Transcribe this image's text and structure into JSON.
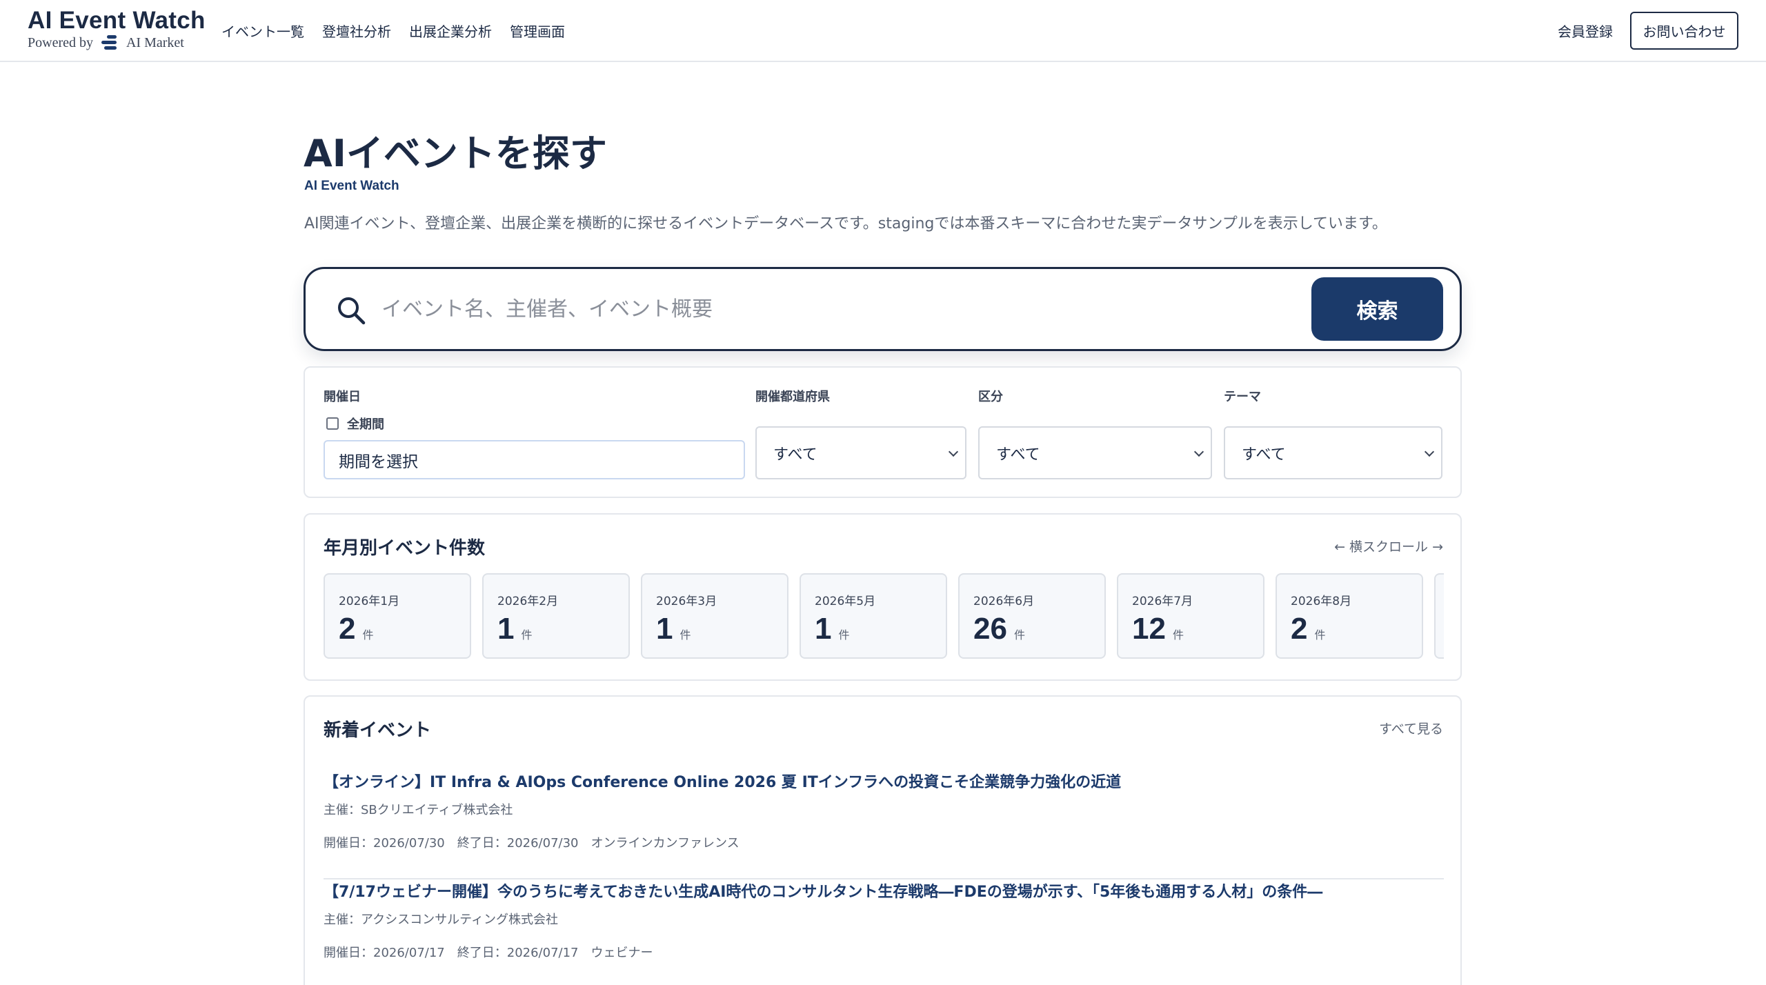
{
  "header": {
    "logo_title": "AI Event Watch",
    "logo_powered": "Powered by",
    "logo_brand": "AI Market",
    "nav": [
      "イベント一覧",
      "登壇社分析",
      "出展企業分析",
      "管理画面"
    ],
    "register_label": "会員登録",
    "contact_label": "お問い合わせ"
  },
  "hero": {
    "title": "AIイベントを探す",
    "subtitle": "AI Event Watch",
    "description": "AI関連イベント、登壇企業、出展企業を横断的に探せるイベントデータベースです。stagingでは本番スキーマに合わせた実データサンプルを表示しています。"
  },
  "search": {
    "placeholder": "イベント名、主催者、イベント概要",
    "button_label": "検索",
    "icon": "search-icon"
  },
  "filters": {
    "date_label": "開催日",
    "all_period_label": "全期間",
    "all_period_checked": false,
    "date_placeholder": "期間を選択",
    "prefecture_label": "開催都道府県",
    "prefecture_value": "すべて",
    "category_label": "区分",
    "category_value": "すべて",
    "theme_label": "テーマ",
    "theme_value": "すべて"
  },
  "monthly": {
    "title": "年月別イベント件数",
    "scroll_hint": "← 横スクロール →",
    "unit": "件",
    "months": [
      {
        "label": "2026年1月",
        "count": "2"
      },
      {
        "label": "2026年2月",
        "count": "1"
      },
      {
        "label": "2026年3月",
        "count": "1"
      },
      {
        "label": "2026年5月",
        "count": "1"
      },
      {
        "label": "2026年6月",
        "count": "26"
      },
      {
        "label": "2026年7月",
        "count": "12"
      },
      {
        "label": "2026年8月",
        "count": "2"
      }
    ]
  },
  "events": {
    "title": "新着イベント",
    "see_all_label": "すべて見る",
    "items": [
      {
        "title": "【オンライン】IT Infra & AIOps Conference Online 2026 夏 ITインフラへの投資こそ企業競争力強化の近道",
        "host": "主催：SBクリエイティブ株式会社",
        "start": "開催日：2026/07/30",
        "end": "終了日：2026/07/30",
        "type": "オンラインカンファレンス"
      },
      {
        "title": "【7/17ウェビナー開催】今のうちに考えておきたい生成AI時代のコンサルタント生存戦略―FDEの登場が示す、「5年後も通用する人材」の条件―",
        "host": "主催：アクシスコンサルティング株式会社",
        "start": "開催日：2026/07/17",
        "end": "終了日：2026/07/17",
        "type": "ウェビナー"
      }
    ]
  }
}
